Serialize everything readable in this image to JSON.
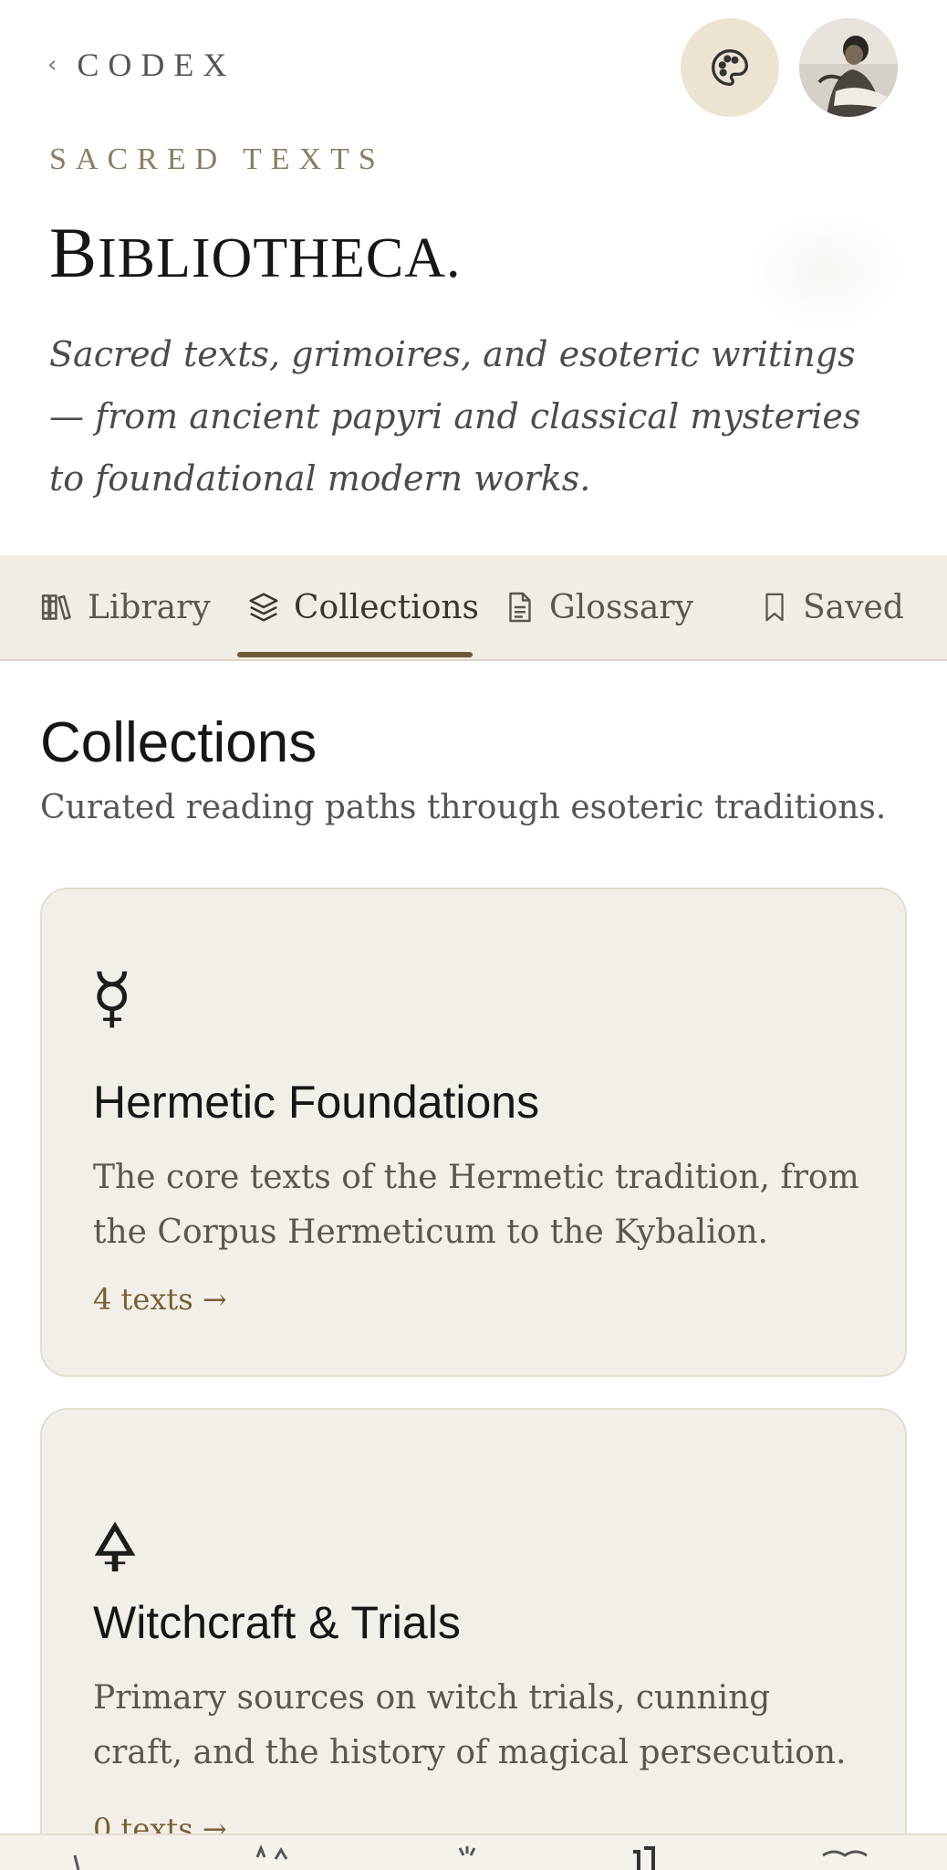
{
  "header": {
    "back_label": "CODEX",
    "eyebrow": "SACRED TEXTS",
    "title_first": "B",
    "title_rest": "IBLIOTHECA.",
    "subtitle": "Sacred texts, grimoires, and esoteric writings — from ancient papyri and classical mysteries to foundational modern works."
  },
  "tabs": [
    {
      "label": "Library",
      "icon": "books-icon"
    },
    {
      "label": "Collections",
      "icon": "layers-icon",
      "active": true
    },
    {
      "label": "Glossary",
      "icon": "document-icon"
    },
    {
      "label": "Saved",
      "icon": "bookmark-icon"
    }
  ],
  "section": {
    "title": "Collections",
    "subtitle": "Curated reading paths through esoteric traditions."
  },
  "collections": [
    {
      "glyph": "☿",
      "name": "Hermetic Foundations",
      "description": "The core texts of the Hermetic tradition, from the Corpus Hermeticum to the Kybalion.",
      "count": "4 texts →"
    },
    {
      "glyph": "🜍",
      "name": "Witchcraft & Trials",
      "description": "Primary sources on witch trials, cunning craft, and the history of magical persecution.",
      "count": "0 texts →"
    }
  ],
  "colors": {
    "accent": "#6e5a3a",
    "tab_bg": "#f2ede4",
    "card_bg": "#f2efe9",
    "palette_bg": "#ece3d1"
  }
}
